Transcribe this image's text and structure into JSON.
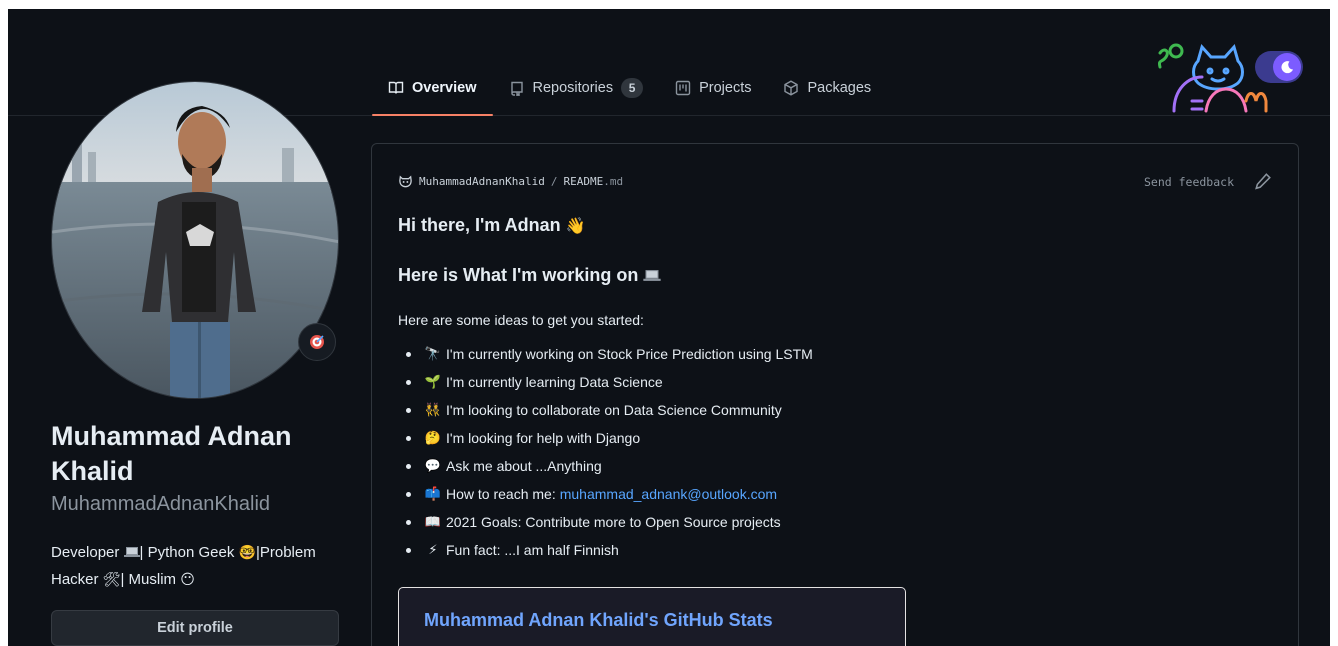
{
  "tabs": [
    {
      "label": "Overview",
      "icon": "book-icon",
      "active": true
    },
    {
      "label": "Repositories",
      "icon": "repo-icon",
      "count": "5"
    },
    {
      "label": "Projects",
      "icon": "project-icon"
    },
    {
      "label": "Packages",
      "icon": "package-icon"
    }
  ],
  "profile": {
    "name": "Muhammad Adnan Khalid",
    "login": "MuhammadAdnanKhalid",
    "bio_parts": [
      "Developer",
      "| Python Geek",
      "|Problem Hacker",
      "| Muslim"
    ],
    "edit_label": "Edit profile"
  },
  "readme": {
    "owner": "MuhammadAdnanKhalid",
    "separator": "/",
    "file": "README",
    "ext": ".md",
    "feedback": "Send feedback",
    "heading1": "Hi there, I'm Adnan",
    "heading2": "Here is What I'm working on",
    "intro": "Here are some ideas to get you started:",
    "items": [
      {
        "emoji": "🔭",
        "text": "I'm currently working on Stock Price Prediction using LSTM"
      },
      {
        "emoji": "🌱",
        "text": "I'm currently learning Data Science"
      },
      {
        "emoji": "👯",
        "text": "I'm looking to collaborate on Data Science Community"
      },
      {
        "emoji": "🤔",
        "text": "I'm looking for help with Django"
      },
      {
        "emoji": "💬",
        "text": "Ask me about ...Anything"
      },
      {
        "emoji": "📫",
        "text": "How to reach me:",
        "link": "muhammad_adnank@outlook.com"
      },
      {
        "emoji": "📖",
        "text": "2021 Goals: Contribute more to Open Source projects"
      },
      {
        "emoji": "⚡",
        "text": "Fun fact: ...I am half Finnish"
      }
    ],
    "stats_title": "Muhammad Adnan Khalid's GitHub Stats"
  },
  "colors": {
    "background": "#0d1117",
    "accent_tab": "#f78166",
    "link": "#58a6ff",
    "stats_title": "#70a5fd"
  }
}
